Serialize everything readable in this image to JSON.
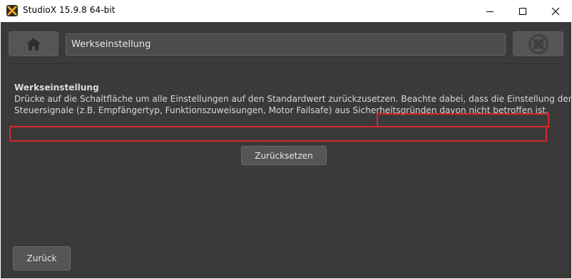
{
  "window": {
    "title": "StudioX 15.9.8  64-bit",
    "app_icon": "studiox-logo-icon",
    "controls": [
      "minimize-icon",
      "maximize-icon",
      "close-icon"
    ]
  },
  "toolbar": {
    "home_icon": "home-icon",
    "breadcrumb": "Werkseinstellung",
    "stop_icon": "stop-icon"
  },
  "content": {
    "title": "Werkseinstellung",
    "line1_part1": "Drücke auf die Schaltfläche um alle Einstellungen auf den Standardwert zurückzusetzen.",
    "line1_part2": "Beachte dabei, dass die Einstellung der",
    "line2": "Steuersignale (z.B. Empfängertyp, Funktionszuweisungen, Motor Failsafe) aus Sicherheitsgründen davon nicht betroffen ist."
  },
  "buttons": {
    "reset": "Zurücksetzen",
    "back": "Zurück"
  },
  "colors": {
    "background": "#3a3a3a",
    "button": "#555555",
    "highlight": "#d9272e"
  }
}
